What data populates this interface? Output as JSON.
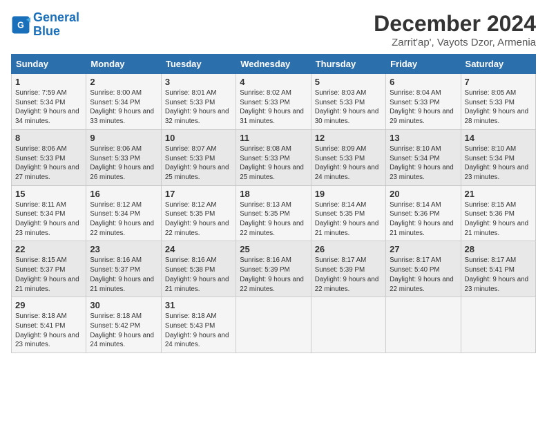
{
  "logo": {
    "line1": "General",
    "line2": "Blue"
  },
  "title": "December 2024",
  "subtitle": "Zarrit'ap', Vayots Dzor, Armenia",
  "days_of_week": [
    "Sunday",
    "Monday",
    "Tuesday",
    "Wednesday",
    "Thursday",
    "Friday",
    "Saturday"
  ],
  "weeks": [
    [
      {
        "day": 1,
        "sunrise": "7:59 AM",
        "sunset": "5:34 PM",
        "daylight": "9 hours and 34 minutes."
      },
      {
        "day": 2,
        "sunrise": "8:00 AM",
        "sunset": "5:34 PM",
        "daylight": "9 hours and 33 minutes."
      },
      {
        "day": 3,
        "sunrise": "8:01 AM",
        "sunset": "5:33 PM",
        "daylight": "9 hours and 32 minutes."
      },
      {
        "day": 4,
        "sunrise": "8:02 AM",
        "sunset": "5:33 PM",
        "daylight": "9 hours and 31 minutes."
      },
      {
        "day": 5,
        "sunrise": "8:03 AM",
        "sunset": "5:33 PM",
        "daylight": "9 hours and 30 minutes."
      },
      {
        "day": 6,
        "sunrise": "8:04 AM",
        "sunset": "5:33 PM",
        "daylight": "9 hours and 29 minutes."
      },
      {
        "day": 7,
        "sunrise": "8:05 AM",
        "sunset": "5:33 PM",
        "daylight": "9 hours and 28 minutes."
      }
    ],
    [
      {
        "day": 8,
        "sunrise": "8:06 AM",
        "sunset": "5:33 PM",
        "daylight": "9 hours and 27 minutes."
      },
      {
        "day": 9,
        "sunrise": "8:06 AM",
        "sunset": "5:33 PM",
        "daylight": "9 hours and 26 minutes."
      },
      {
        "day": 10,
        "sunrise": "8:07 AM",
        "sunset": "5:33 PM",
        "daylight": "9 hours and 25 minutes."
      },
      {
        "day": 11,
        "sunrise": "8:08 AM",
        "sunset": "5:33 PM",
        "daylight": "9 hours and 25 minutes."
      },
      {
        "day": 12,
        "sunrise": "8:09 AM",
        "sunset": "5:33 PM",
        "daylight": "9 hours and 24 minutes."
      },
      {
        "day": 13,
        "sunrise": "8:10 AM",
        "sunset": "5:34 PM",
        "daylight": "9 hours and 23 minutes."
      },
      {
        "day": 14,
        "sunrise": "8:10 AM",
        "sunset": "5:34 PM",
        "daylight": "9 hours and 23 minutes."
      }
    ],
    [
      {
        "day": 15,
        "sunrise": "8:11 AM",
        "sunset": "5:34 PM",
        "daylight": "9 hours and 23 minutes."
      },
      {
        "day": 16,
        "sunrise": "8:12 AM",
        "sunset": "5:34 PM",
        "daylight": "9 hours and 22 minutes."
      },
      {
        "day": 17,
        "sunrise": "8:12 AM",
        "sunset": "5:35 PM",
        "daylight": "9 hours and 22 minutes."
      },
      {
        "day": 18,
        "sunrise": "8:13 AM",
        "sunset": "5:35 PM",
        "daylight": "9 hours and 22 minutes."
      },
      {
        "day": 19,
        "sunrise": "8:14 AM",
        "sunset": "5:35 PM",
        "daylight": "9 hours and 21 minutes."
      },
      {
        "day": 20,
        "sunrise": "8:14 AM",
        "sunset": "5:36 PM",
        "daylight": "9 hours and 21 minutes."
      },
      {
        "day": 21,
        "sunrise": "8:15 AM",
        "sunset": "5:36 PM",
        "daylight": "9 hours and 21 minutes."
      }
    ],
    [
      {
        "day": 22,
        "sunrise": "8:15 AM",
        "sunset": "5:37 PM",
        "daylight": "9 hours and 21 minutes."
      },
      {
        "day": 23,
        "sunrise": "8:16 AM",
        "sunset": "5:37 PM",
        "daylight": "9 hours and 21 minutes."
      },
      {
        "day": 24,
        "sunrise": "8:16 AM",
        "sunset": "5:38 PM",
        "daylight": "9 hours and 21 minutes."
      },
      {
        "day": 25,
        "sunrise": "8:16 AM",
        "sunset": "5:39 PM",
        "daylight": "9 hours and 22 minutes."
      },
      {
        "day": 26,
        "sunrise": "8:17 AM",
        "sunset": "5:39 PM",
        "daylight": "9 hours and 22 minutes."
      },
      {
        "day": 27,
        "sunrise": "8:17 AM",
        "sunset": "5:40 PM",
        "daylight": "9 hours and 22 minutes."
      },
      {
        "day": 28,
        "sunrise": "8:17 AM",
        "sunset": "5:41 PM",
        "daylight": "9 hours and 23 minutes."
      }
    ],
    [
      {
        "day": 29,
        "sunrise": "8:18 AM",
        "sunset": "5:41 PM",
        "daylight": "9 hours and 23 minutes."
      },
      {
        "day": 30,
        "sunrise": "8:18 AM",
        "sunset": "5:42 PM",
        "daylight": "9 hours and 24 minutes."
      },
      {
        "day": 31,
        "sunrise": "8:18 AM",
        "sunset": "5:43 PM",
        "daylight": "9 hours and 24 minutes."
      },
      null,
      null,
      null,
      null
    ]
  ]
}
